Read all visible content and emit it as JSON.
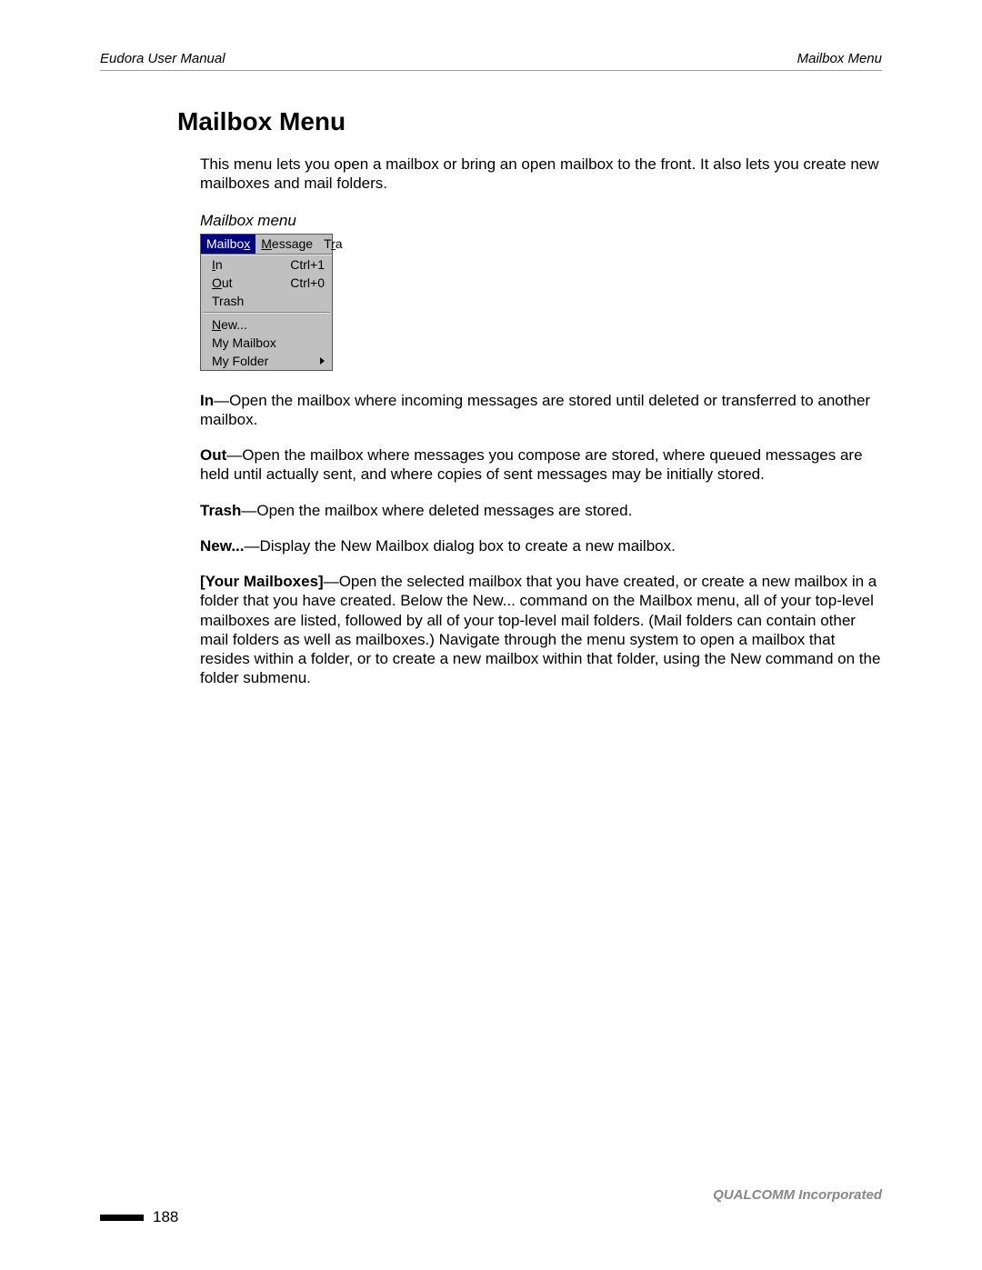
{
  "header": {
    "left": "Eudora User Manual",
    "right": "Mailbox Menu"
  },
  "section_title": "Mailbox Menu",
  "intro": "This menu lets you open a mailbox or bring an open mailbox to the front. It also lets you create new mailboxes and mail folders.",
  "figure_caption": "Mailbox menu",
  "menubar": {
    "mailbox": {
      "pre": "Mailbo",
      "m": "x"
    },
    "message": {
      "m": "M",
      "post": "essage"
    },
    "transfer": {
      "pre": "T",
      "m": "r",
      "post": "a"
    }
  },
  "menu_items": {
    "in": {
      "m": "I",
      "post": "n",
      "shortcut": "Ctrl+1"
    },
    "out": {
      "m": "O",
      "post": "ut",
      "shortcut": "Ctrl+0"
    },
    "trash": {
      "label": "Trash",
      "shortcut": ""
    },
    "new": {
      "m": "N",
      "post": "ew...",
      "shortcut": ""
    },
    "my_mailbox": {
      "label": "My Mailbox",
      "shortcut": ""
    },
    "my_folder": {
      "label": "My Folder",
      "shortcut": ""
    }
  },
  "defs": {
    "in": {
      "term": "In",
      "text": "—Open the mailbox where incoming messages are stored until deleted or transferred to another mailbox."
    },
    "out": {
      "term": "Out",
      "text": "—Open the mailbox where messages you compose are stored, where queued messages are held until actually sent, and where copies of sent messages may be initially stored."
    },
    "trash": {
      "term": "Trash",
      "text": "—Open the mailbox where deleted messages are stored."
    },
    "new": {
      "term": "New...",
      "text": "—Display the New Mailbox dialog box to create a new mailbox."
    },
    "your": {
      "term": "[Your Mailboxes]",
      "text": "—Open the selected mailbox that you have created, or create a new mailbox in a folder that you have created. Below the New... command on the Mailbox menu, all of your top-level mailboxes are listed, followed by all of your top-level mail folders. (Mail folders can contain other mail folders as well as mailboxes.) Navigate through the menu system to open a mailbox that resides within a folder, or to create a new mailbox within that folder, using the New command on the folder submenu."
    }
  },
  "footer": {
    "company": "QUALCOMM Incorporated",
    "page": "188"
  }
}
